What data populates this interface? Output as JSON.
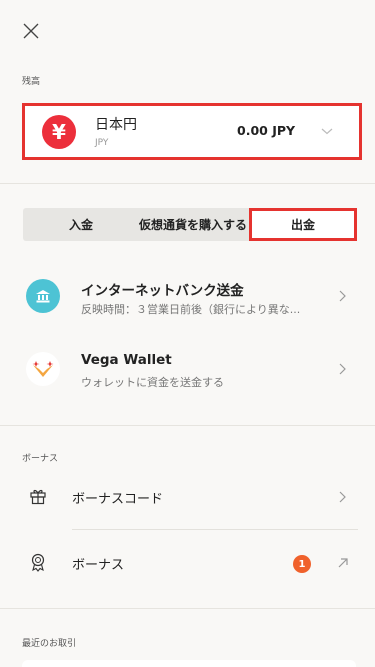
{
  "balance": {
    "section_label": "残高",
    "currency_name": "日本円",
    "currency_code": "JPY",
    "amount": "0.00 JPY",
    "icon_symbol": "¥"
  },
  "tabs": [
    {
      "label": "入金"
    },
    {
      "label": "仮想通貨を購入する"
    },
    {
      "label": "出金",
      "active": true
    }
  ],
  "methods": [
    {
      "title": "インターネットバンク送金",
      "subtitle": "反映時間：３営業日前後（銀行により異な...",
      "icon": "bank-icon"
    },
    {
      "title": "Vega Wallet",
      "subtitle": "ウォレットに資金を送金する",
      "icon": "vega-wallet-icon"
    }
  ],
  "bonus": {
    "section_label": "ボーナス",
    "code_label": "ボーナスコード",
    "bonus_label": "ボーナス",
    "badge_count": "1"
  },
  "recent": {
    "section_label": "最近のお取引"
  },
  "colors": {
    "highlight": "#e5332f",
    "yen_icon": "#ec2f3b",
    "bank_icon": "#4dc3d4",
    "badge": "#f0612b"
  }
}
